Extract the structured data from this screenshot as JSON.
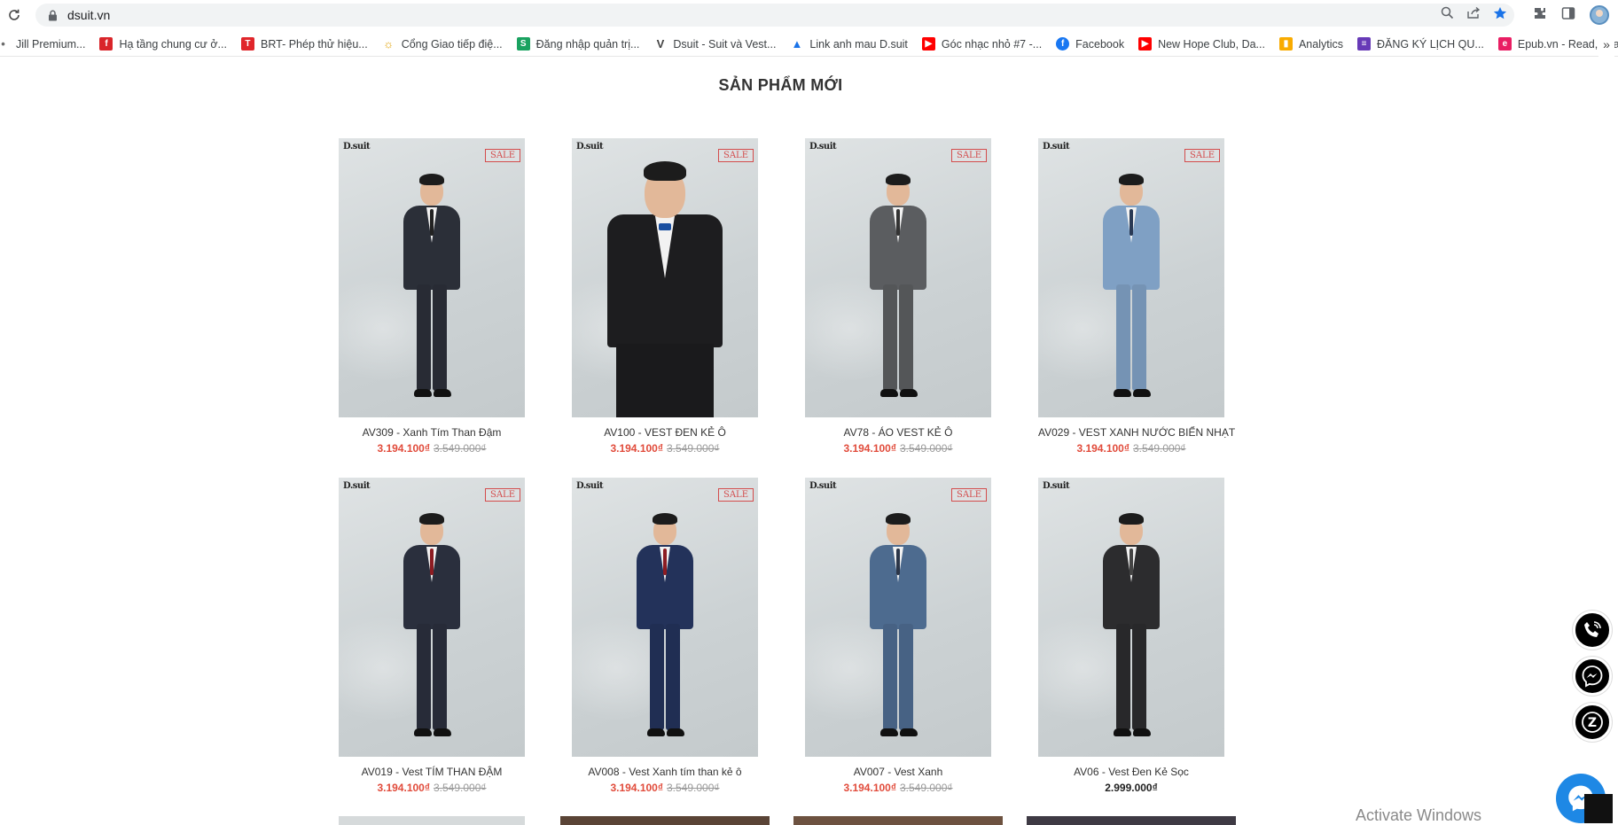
{
  "browser": {
    "url": "dsuit.vn",
    "bookmarks": [
      {
        "label": "Jill Premium...",
        "icon": "generic-icon",
        "color": "#6b6b6b"
      },
      {
        "label": "Hạ tầng chung cư ở...",
        "icon": "flipboard-icon",
        "color": "#d9252a"
      },
      {
        "label": "BRT- Phép thử hiệu...",
        "icon": "tp-icon",
        "color": "#e0262b"
      },
      {
        "label": "Cổng Giao tiếp điệ...",
        "icon": "gov-icon",
        "color": "#e0a000"
      },
      {
        "label": "Đăng nhập quản trị...",
        "icon": "s-icon",
        "color": "#1aa260"
      },
      {
        "label": "Dsuit - Suit và Vest...",
        "icon": "dsuit-icon",
        "color": "#444444"
      },
      {
        "label": "Link anh mau D.suit",
        "icon": "drive-icon",
        "color": "#1a73e8"
      },
      {
        "label": "Góc nhạc nhỏ #7 -...",
        "icon": "youtube-icon",
        "color": "#ff0000"
      },
      {
        "label": "Facebook",
        "icon": "facebook-icon",
        "color": "#1877f2"
      },
      {
        "label": "New Hope Club, Da...",
        "icon": "youtube-icon",
        "color": "#ff0000"
      },
      {
        "label": "Analytics",
        "icon": "analytics-icon",
        "color": "#f9ab00"
      },
      {
        "label": "ĐĂNG KÝ LỊCH QU...",
        "icon": "forms-icon",
        "color": "#673ab7"
      },
      {
        "label": "Epub.vn - Read, Lea...",
        "icon": "epub-icon",
        "color": "#e91e63"
      }
    ],
    "bookmarks_more": "»"
  },
  "page": {
    "section_title": "SẢN PHẨM MỚI",
    "logo_text": "D.suit",
    "sale_label": "SALE",
    "products": [
      {
        "name": "AV309 - Xanh Tím Than Đậm",
        "price": "3.194.100₫",
        "old_price": "3.549.000₫",
        "sale": true,
        "suit": "#2b2f38",
        "tie": "#222"
      },
      {
        "name": "AV100 - VEST ĐEN KẺ Ô",
        "price": "3.194.100₫",
        "old_price": "3.549.000₫",
        "sale": true,
        "suit": "#1d1d1f",
        "tie": "#1a4fa0"
      },
      {
        "name": "AV78 - ÁO VEST KẺ Ô",
        "price": "3.194.100₫",
        "old_price": "3.549.000₫",
        "sale": true,
        "suit": "#5b5d60",
        "tie": "#333"
      },
      {
        "name": "AV029 - VEST XANH NƯỚC BIỂN NHẠT",
        "price": "3.194.100₫",
        "old_price": "3.549.000₫",
        "sale": true,
        "suit": "#7fa0c4",
        "tie": "#2a3a55"
      },
      {
        "name": "AV019 - Vest TÍM THAN ĐẬM",
        "price": "3.194.100₫",
        "old_price": "3.549.000₫",
        "sale": true,
        "suit": "#2a2f3d",
        "tie": "#8c1c22"
      },
      {
        "name": "AV008 - Vest Xanh tím than kẻ ô",
        "price": "3.194.100₫",
        "old_price": "3.549.000₫",
        "sale": true,
        "suit": "#23325a",
        "tie": "#8c1c22"
      },
      {
        "name": "AV007 - Vest Xanh",
        "price": "3.194.100₫",
        "old_price": "3.549.000₫",
        "sale": true,
        "suit": "#4d6b8f",
        "tie": "#2c3648"
      },
      {
        "name": "AV06 - Vest Đen Kẻ Sọc",
        "price": "2.999.000₫",
        "old_price": "",
        "sale": false,
        "suit": "#2c2c2e",
        "tie": "#444"
      }
    ]
  },
  "overlay": {
    "activate_windows": "Activate Windows"
  },
  "colors": {
    "price_red": "#e14b3b",
    "messenger_blue": "#1e88e5"
  }
}
